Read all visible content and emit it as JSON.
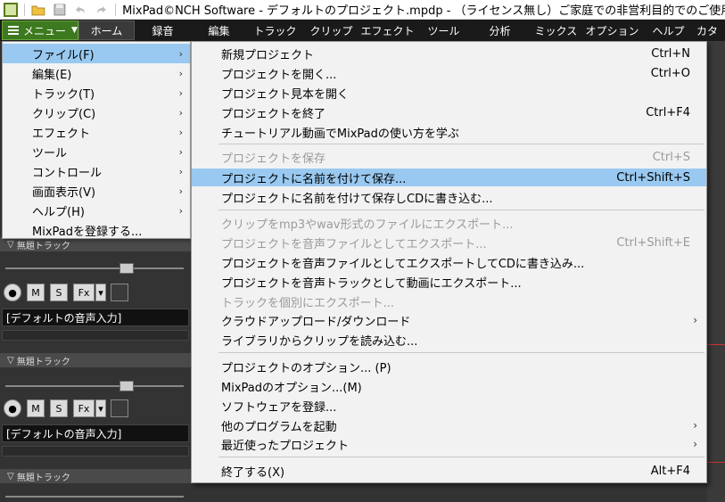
{
  "titlebar": {
    "title": "MixPad©NCH Software - デフォルトのプロジェクト.mpdp - （ライセンス無し）ご家庭での非営利目的でのご使用"
  },
  "tabbar": {
    "menu_label": "メニュー",
    "tabs": [
      "ホーム",
      "録音",
      "編集",
      "トラック",
      "クリップ",
      "エフェクト",
      "ツール",
      "分析",
      "ミックス",
      "オプション",
      "ヘルプ",
      "カタ"
    ]
  },
  "tracks": [
    {
      "header": "無題トラック",
      "input": "[デフォルトの音声入力]"
    },
    {
      "header": "無題トラック",
      "input": "[デフォルトの音声入力]"
    },
    {
      "header": "無題トラック"
    }
  ],
  "track_buttons": {
    "mute": "M",
    "solo": "S",
    "fx": "Fx"
  },
  "main_menu": {
    "items": [
      {
        "label": "ファイル(F)"
      },
      {
        "label": "編集(E)"
      },
      {
        "label": "トラック(T)"
      },
      {
        "label": "クリップ(C)"
      },
      {
        "label": "エフェクト"
      },
      {
        "label": "ツール"
      },
      {
        "label": "コントロール"
      },
      {
        "label": "画面表示(V)"
      },
      {
        "label": "ヘルプ(H)"
      },
      {
        "label": "MixPadを登録する..."
      }
    ]
  },
  "file_menu": {
    "items": [
      {
        "label": "新規プロジェクト",
        "shortcut": "Ctrl+N"
      },
      {
        "label": "プロジェクトを開く...",
        "shortcut": "Ctrl+O"
      },
      {
        "label": "プロジェクト見本を開く",
        "shortcut": ""
      },
      {
        "label": "プロジェクトを終了",
        "shortcut": "Ctrl+F4"
      },
      {
        "label": "チュートリアル動画でMixPadの使い方を学ぶ",
        "shortcut": ""
      },
      {
        "label": "プロジェクトを保存",
        "shortcut": "Ctrl+S"
      },
      {
        "label": "プロジェクトに名前を付けて保存...",
        "shortcut": "Ctrl+Shift+S"
      },
      {
        "label": "プロジェクトに名前を付けて保存しCDに書き込む...",
        "shortcut": ""
      },
      {
        "label": "クリップをmp3やwav形式のファイルにエクスポート...",
        "shortcut": ""
      },
      {
        "label": "プロジェクトを音声ファイルとしてエクスポート...",
        "shortcut": "Ctrl+Shift+E"
      },
      {
        "label": "プロジェクトを音声ファイルとしてエクスポートしてCDに書き込み...",
        "shortcut": ""
      },
      {
        "label": "プロジェクトを音声トラックとして動画にエクスポート...",
        "shortcut": ""
      },
      {
        "label": "トラックを個別にエクスポート...",
        "shortcut": ""
      },
      {
        "label": "クラウドアップロード/ダウンロード",
        "shortcut": ""
      },
      {
        "label": "ライブラリからクリップを読み込む...",
        "shortcut": ""
      },
      {
        "label": "プロジェクトのオプション... (P)",
        "shortcut": ""
      },
      {
        "label": "MixPadのオプション...(M)",
        "shortcut": ""
      },
      {
        "label": "ソフトウェアを登録...",
        "shortcut": ""
      },
      {
        "label": "他のプログラムを起動",
        "shortcut": ""
      },
      {
        "label": "最近使ったプロジェクト",
        "shortcut": ""
      },
      {
        "label": "終了する(X)",
        "shortcut": "Alt+F4"
      }
    ]
  }
}
